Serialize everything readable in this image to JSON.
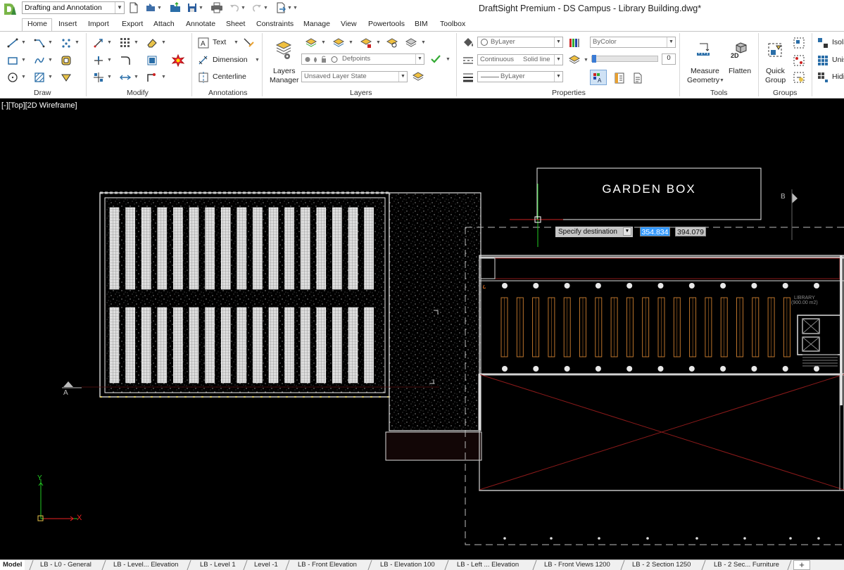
{
  "title_bar": {
    "workspace": "Drafting and Annotation",
    "window_title": "DraftSight Premium - DS Campus - Library Building.dwg*"
  },
  "menu_tabs": [
    "Home",
    "Insert",
    "Import",
    "Export",
    "Attach",
    "Annotate",
    "Sheet",
    "Constraints",
    "Manage",
    "View",
    "Powertools",
    "BIM",
    "Toolbox"
  ],
  "ribbon": {
    "groups": {
      "draw": "Draw",
      "modify": "Modify",
      "annotations": "Annotations",
      "layers": "Layers",
      "properties": "Properties",
      "tools": "Tools",
      "groups": "Groups"
    },
    "annotations": {
      "text": "Text",
      "dimension": "Dimension",
      "centerline": "Centerline"
    },
    "layers": {
      "manager_line1": "Layers",
      "manager_line2": "Manager",
      "current_layer": "Defpoints",
      "layer_state": "Unsaved Layer State"
    },
    "properties": {
      "color": "ByLayer",
      "linetype": "Continuous",
      "linetype_mode": "Solid line",
      "lineweight": "ByLayer",
      "plot_style": "ByColor",
      "transparency": "0"
    },
    "tools": {
      "measure_line1": "Measure",
      "measure_line2": "Geometry",
      "flatten": "Flatten",
      "flatten_badge": "2D"
    },
    "groups_panel": {
      "quick_line1": "Quick",
      "quick_line2": "Group"
    },
    "right_cut": {
      "isolate": "Isola",
      "unisolate": "Unis",
      "hide": "Hidi"
    }
  },
  "viewport": {
    "label": "[-][Top][2D Wireframe]",
    "garden_box": "GARDEN BOX",
    "prompt": "Specify destination",
    "coord_x": "354.834",
    "coord_y": "394.079",
    "section_a": "A",
    "section_b": "B",
    "library_label_line1": "LIBRARY",
    "library_label_line2": "(900.00 m2)",
    "axis_y": "Y",
    "axis_x": "X"
  },
  "sheet_tabs": [
    "Model",
    "LB - L0 - General",
    "LB - Level... Elevation",
    "LB - Level 1",
    "Level -1",
    "LB - Front Elevation",
    "LB - Elevation 100",
    "LB - Left ... Elevation",
    "LB - Front Views 1200",
    "LB - 2 Section 1250",
    "LB - 2 Sec... Furniture"
  ],
  "add_sheet": "+",
  "colors": {
    "accent": "#0078d7",
    "background": "#000000",
    "coord_highlight": "#3399ff",
    "furniture": "#d08030",
    "section_red": "#8b1a1a"
  }
}
